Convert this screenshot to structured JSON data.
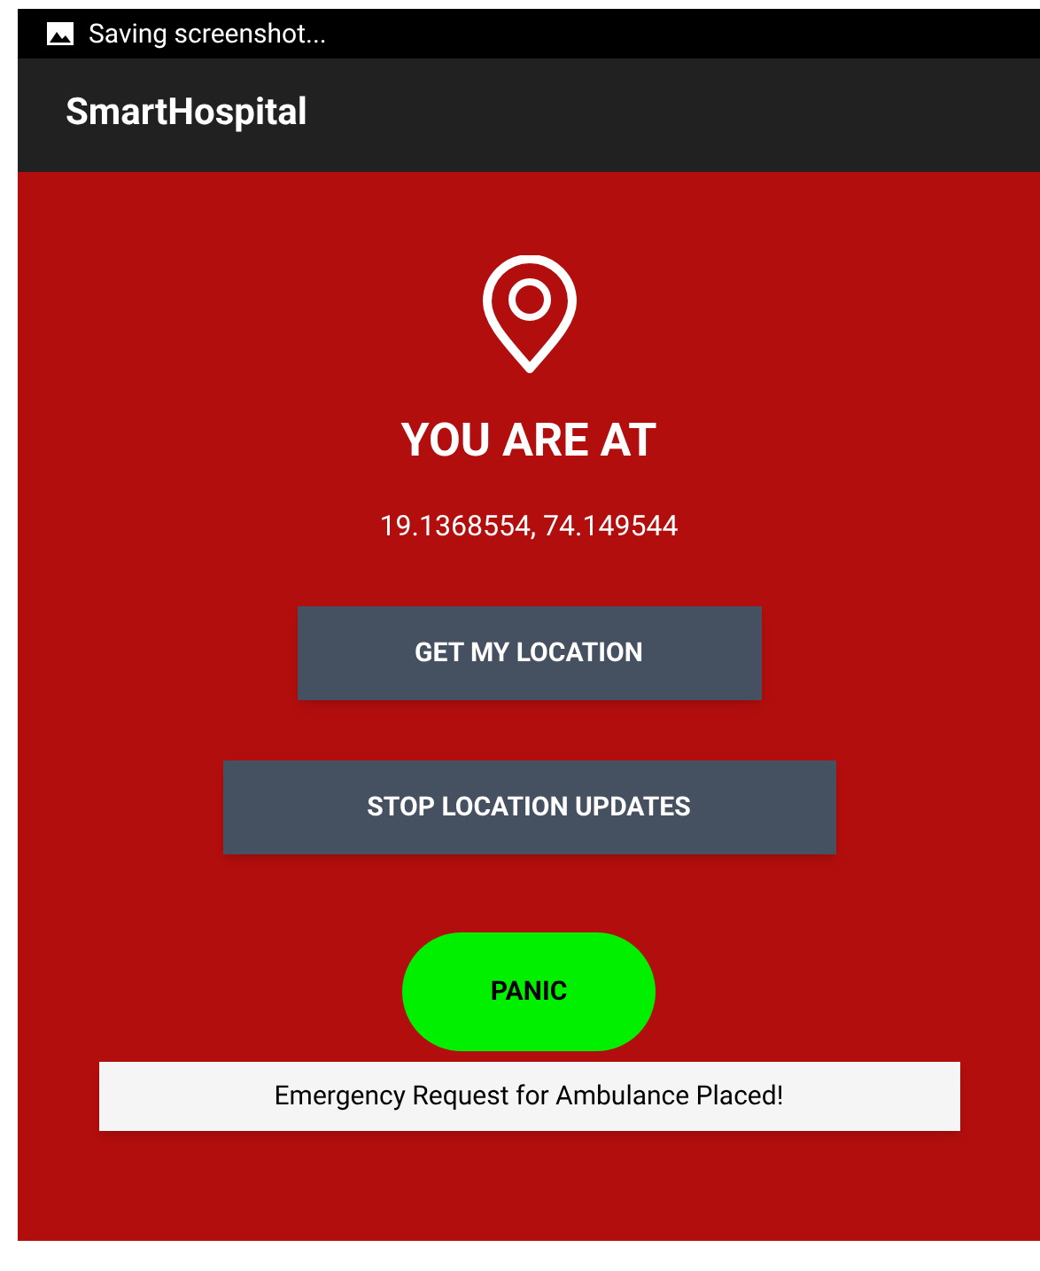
{
  "status_bar": {
    "notification": "Saving screenshot..."
  },
  "app_bar": {
    "title": "SmartHospital"
  },
  "location": {
    "heading": "YOU ARE AT",
    "coordinates": "19.1368554, 74.149544"
  },
  "buttons": [
    {
      "label": "GET MY LOCATION"
    },
    {
      "label": "STOP LOCATION UPDATES"
    }
  ],
  "panic_button": {
    "label": "PANIC"
  },
  "toast": {
    "message": "Emergency Request for Ambulance Placed!"
  }
}
